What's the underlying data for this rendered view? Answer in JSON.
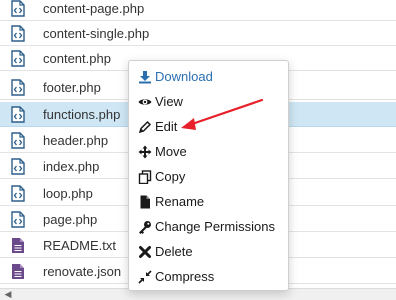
{
  "files": [
    {
      "name": "content-page.php",
      "type": "php"
    },
    {
      "name": "content-single.php",
      "type": "php"
    },
    {
      "name": "content.php",
      "type": "php"
    },
    {
      "name": "footer.php",
      "type": "php"
    },
    {
      "name": "functions.php",
      "type": "php",
      "selected": true
    },
    {
      "name": "header.php",
      "type": "php"
    },
    {
      "name": "index.php",
      "type": "php"
    },
    {
      "name": "loop.php",
      "type": "php"
    },
    {
      "name": "page.php",
      "type": "php"
    },
    {
      "name": "README.txt",
      "type": "text"
    },
    {
      "name": "renovate.json",
      "type": "text"
    }
  ],
  "context_menu": {
    "items": [
      {
        "label": "Download",
        "icon": "download-icon"
      },
      {
        "label": "View",
        "icon": "eye-icon"
      },
      {
        "label": "Edit",
        "icon": "pencil-icon"
      },
      {
        "label": "Move",
        "icon": "move-arrows-icon"
      },
      {
        "label": "Copy",
        "icon": "copy-icon"
      },
      {
        "label": "Rename",
        "icon": "file-icon"
      },
      {
        "label": "Change Permissions",
        "icon": "key-icon"
      },
      {
        "label": "Delete",
        "icon": "x-icon"
      },
      {
        "label": "Compress",
        "icon": "compress-icon"
      }
    ]
  },
  "colors": {
    "selected_row": "#cfe7f5",
    "code_file_icon": "#2d5f8a",
    "text_file_icon": "#6b4a8c",
    "download_link": "#2a6fb0",
    "annotation_arrow": "#e8202a"
  }
}
